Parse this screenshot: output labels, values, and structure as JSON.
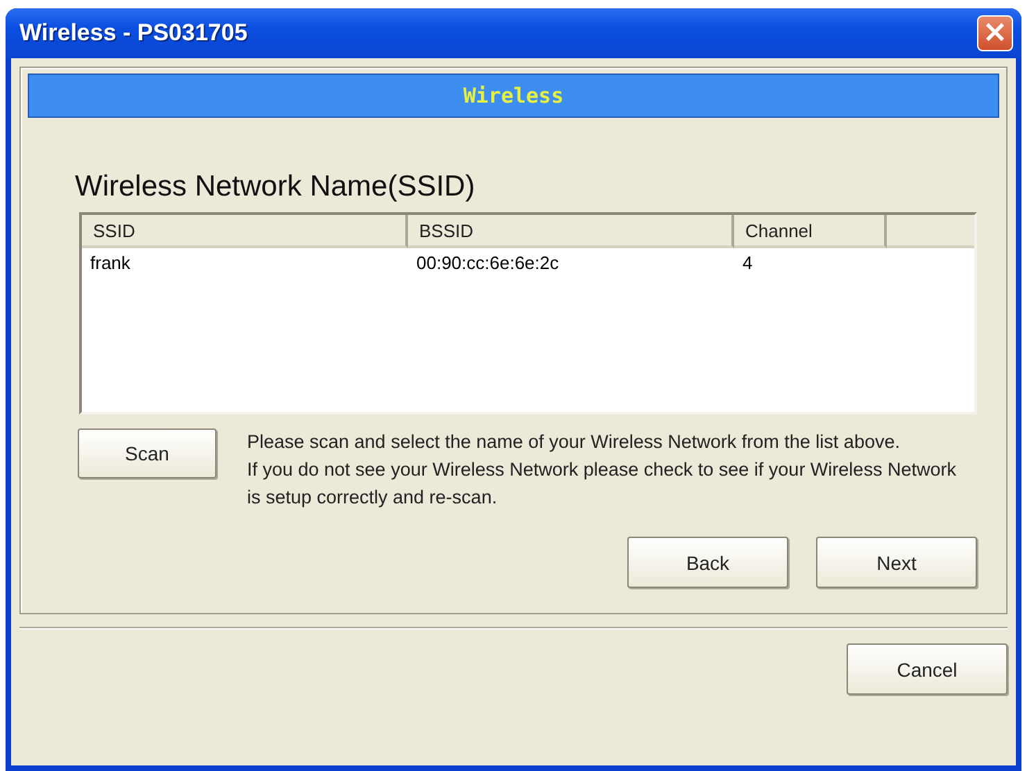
{
  "window": {
    "title": "Wireless - PS031705",
    "close": "×"
  },
  "header": {
    "title": "Wireless"
  },
  "heading": "Wireless Network Name(SSID)",
  "table": {
    "columns": [
      "SSID",
      "BSSID",
      "Channel"
    ],
    "rows": [
      {
        "cells": [
          "frank",
          "00:90:cc:6e:6e:2c",
          "4"
        ],
        "selected": false
      }
    ]
  },
  "scan_button": "Scan",
  "help": [
    "Please scan and select the name of your Wireless Network from the list above.",
    "If you do not see your Wireless Network please check to see if your Wireless Network is setup correctly and re-scan."
  ],
  "nav_buttons": [
    "Back",
    "Next"
  ],
  "footer_buttons": [
    "Cancel"
  ]
}
